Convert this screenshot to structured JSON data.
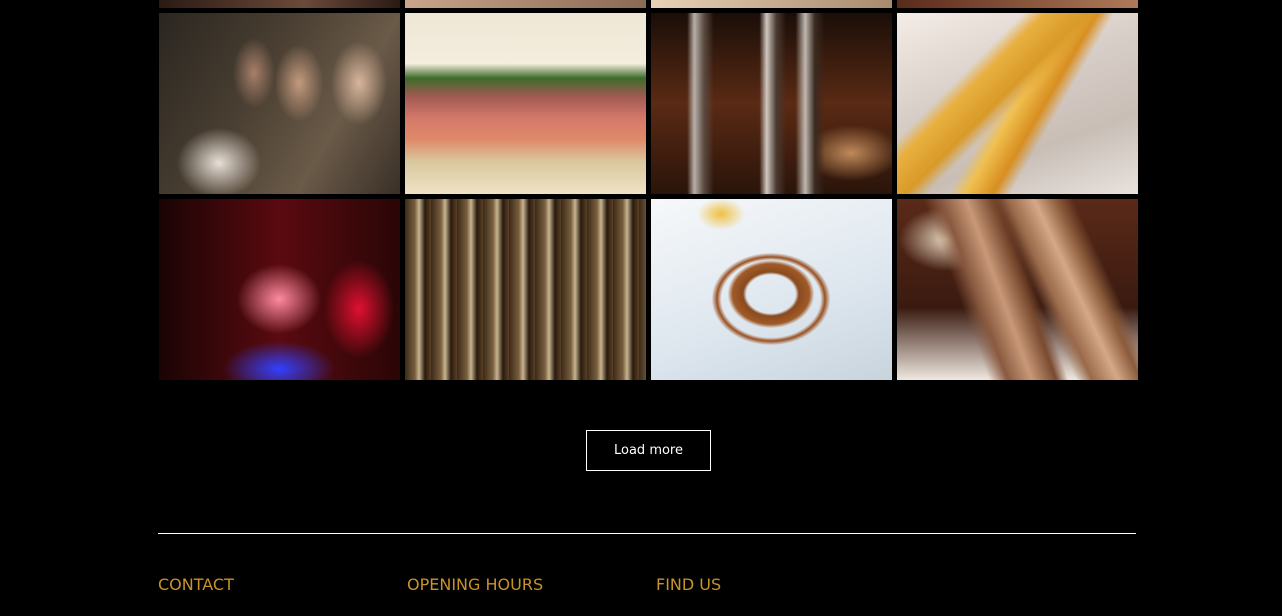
{
  "gallery": {
    "rows": [
      {
        "tiles": [
          {
            "icon": "photo-partial-1"
          },
          {
            "icon": "photo-partial-2"
          },
          {
            "icon": "photo-partial-3"
          },
          {
            "icon": "photo-partial-4"
          }
        ]
      },
      {
        "tiles": [
          {
            "icon": "photo-people-at-bar"
          },
          {
            "icon": "photo-steak-sandwich"
          },
          {
            "icon": "photo-beer-taps"
          },
          {
            "icon": "photo-fries"
          }
        ]
      },
      {
        "tiles": [
          {
            "icon": "photo-friends-toasting"
          },
          {
            "icon": "photo-liquor-bottles"
          },
          {
            "icon": "photo-pretzel"
          },
          {
            "icon": "photo-sausages"
          }
        ]
      }
    ]
  },
  "actions": {
    "load_more_label": "Load more"
  },
  "footer": {
    "contact_heading": "CONTACT",
    "hours_heading": "OPENING HOURS",
    "find_heading": "FIND US"
  },
  "colors": {
    "background": "#000000",
    "accent": "#c9922a",
    "text": "#ffffff"
  }
}
